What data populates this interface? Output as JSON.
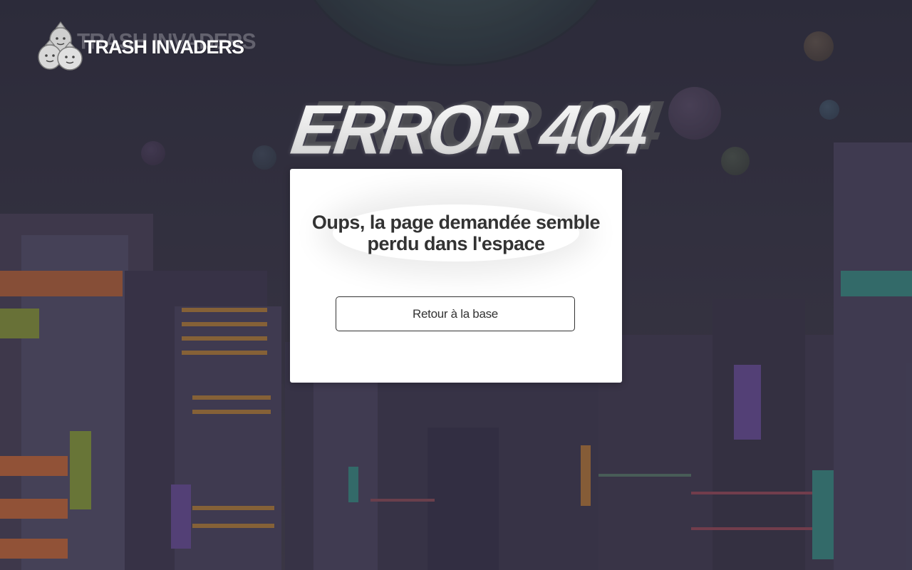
{
  "logo": {
    "text": "TRASH INVADERS",
    "image_name": "trash-bags-mascot"
  },
  "error": {
    "title": "ERROR 404"
  },
  "card": {
    "message": "Oups, la page demandée semble perdu dans l'espace",
    "button_label": "Retour à la base"
  },
  "colors": {
    "card_background": "#ffffff",
    "text_dark": "#333333",
    "background_night": "#3a3847",
    "accent_orange": "#c96a3a",
    "accent_teal": "#3a8f86",
    "accent_purple": "#6a4f9a"
  }
}
